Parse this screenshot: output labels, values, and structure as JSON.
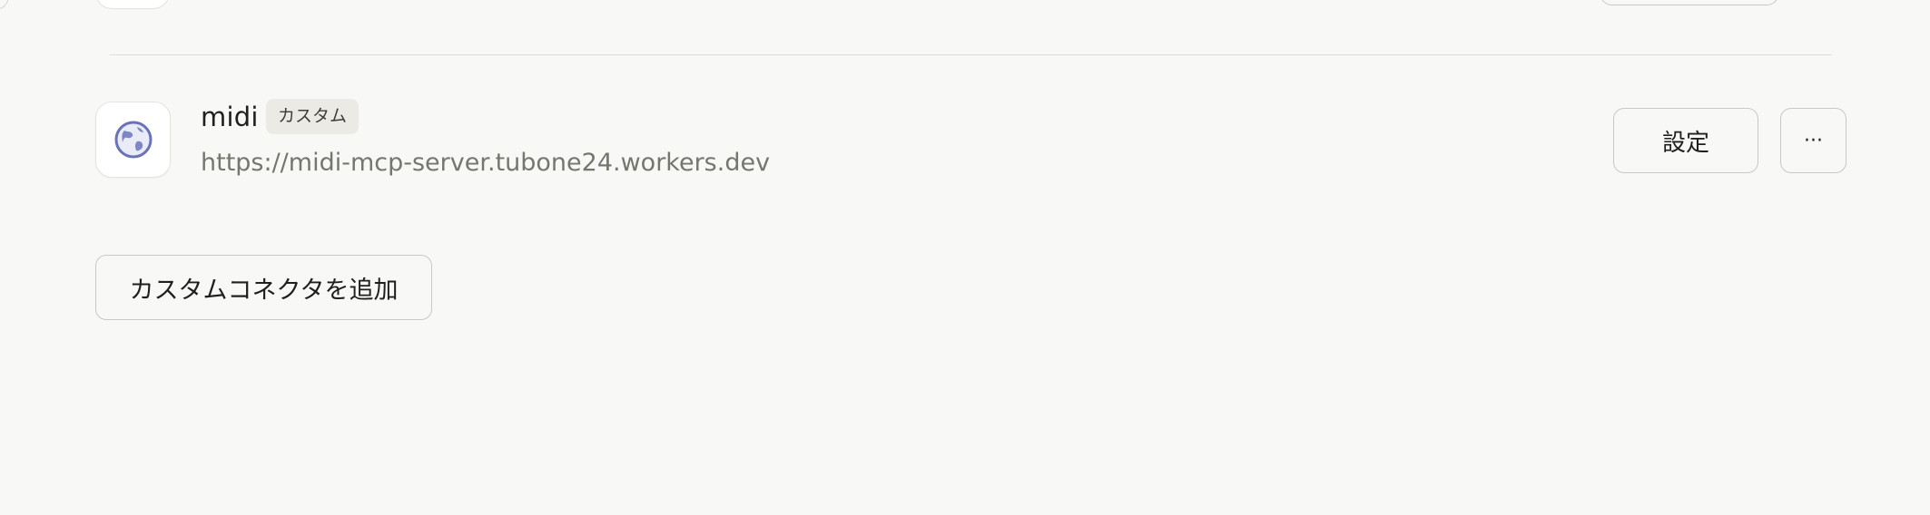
{
  "connector": {
    "name": "midi",
    "badge": "カスタム",
    "url": "https://midi-mcp-server.tubone24.workers.dev",
    "icon": "globe-icon",
    "settings_label": "設定",
    "more_label": "···"
  },
  "actions": {
    "add_custom_connector_label": "カスタムコネクタを追加"
  },
  "colors": {
    "background": "#f8f8f6",
    "border": "#c9c8c3",
    "badge_bg": "#ebeae5",
    "url_text": "#76766f",
    "globe_icon": "#6a72b8"
  }
}
